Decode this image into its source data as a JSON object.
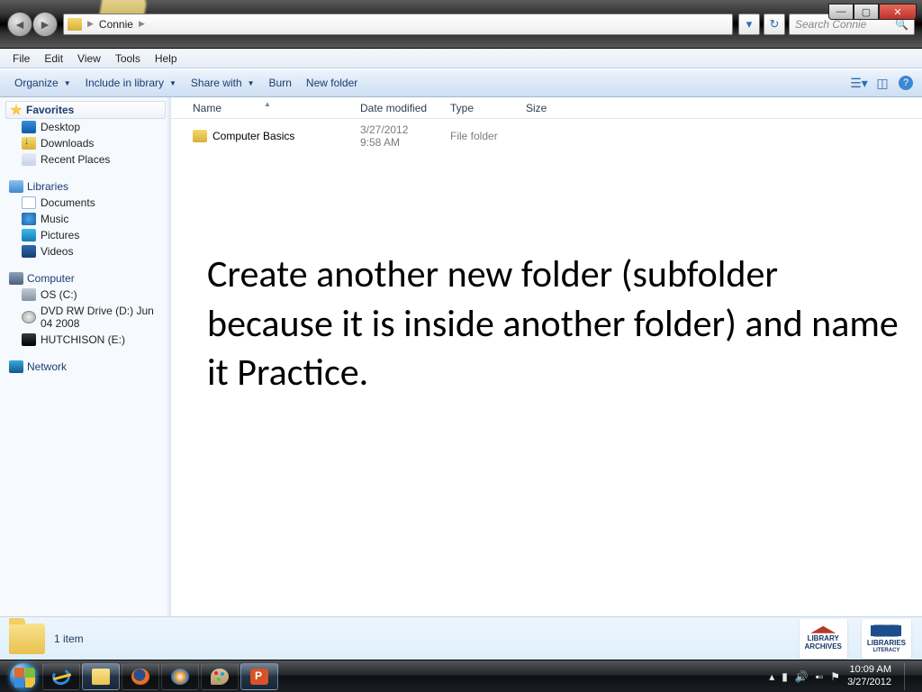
{
  "titlebar": {
    "breadcrumb_root": "Connie",
    "search_placeholder": "Search Connie"
  },
  "window_controls": {
    "min": "—",
    "max": "▢",
    "close": "✕"
  },
  "menubar": {
    "file": "File",
    "edit": "Edit",
    "view": "View",
    "tools": "Tools",
    "help": "Help"
  },
  "toolbar": {
    "organize": "Organize",
    "include": "Include in library",
    "share": "Share with",
    "burn": "Burn",
    "new_folder": "New folder"
  },
  "sidebar": {
    "favorites": {
      "label": "Favorites",
      "desktop": "Desktop",
      "downloads": "Downloads",
      "recent": "Recent Places"
    },
    "libraries": {
      "label": "Libraries",
      "documents": "Documents",
      "music": "Music",
      "pictures": "Pictures",
      "videos": "Videos"
    },
    "computer": {
      "label": "Computer",
      "os": "OS (C:)",
      "dvd": "DVD RW Drive (D:) Jun 04 2008",
      "usb": "HUTCHISON (E:)"
    },
    "network": {
      "label": "Network"
    }
  },
  "columns": {
    "name": "Name",
    "date": "Date modified",
    "type": "Type",
    "size": "Size"
  },
  "rows": [
    {
      "name": "Computer Basics",
      "date": "3/27/2012 9:58 AM",
      "type": "File folder",
      "size": ""
    }
  ],
  "overlay_text": "Create another new folder (subfolder because it is inside another folder) and name it Practice.",
  "details": {
    "status": "1 item"
  },
  "logos": {
    "a_line1": "LIBRARY",
    "a_line2": "ARCHIVES",
    "b_line1": "LIBRARIES",
    "b_line2": "LITERACY"
  },
  "tray": {
    "time": "10:09 AM",
    "date": "3/27/2012"
  }
}
